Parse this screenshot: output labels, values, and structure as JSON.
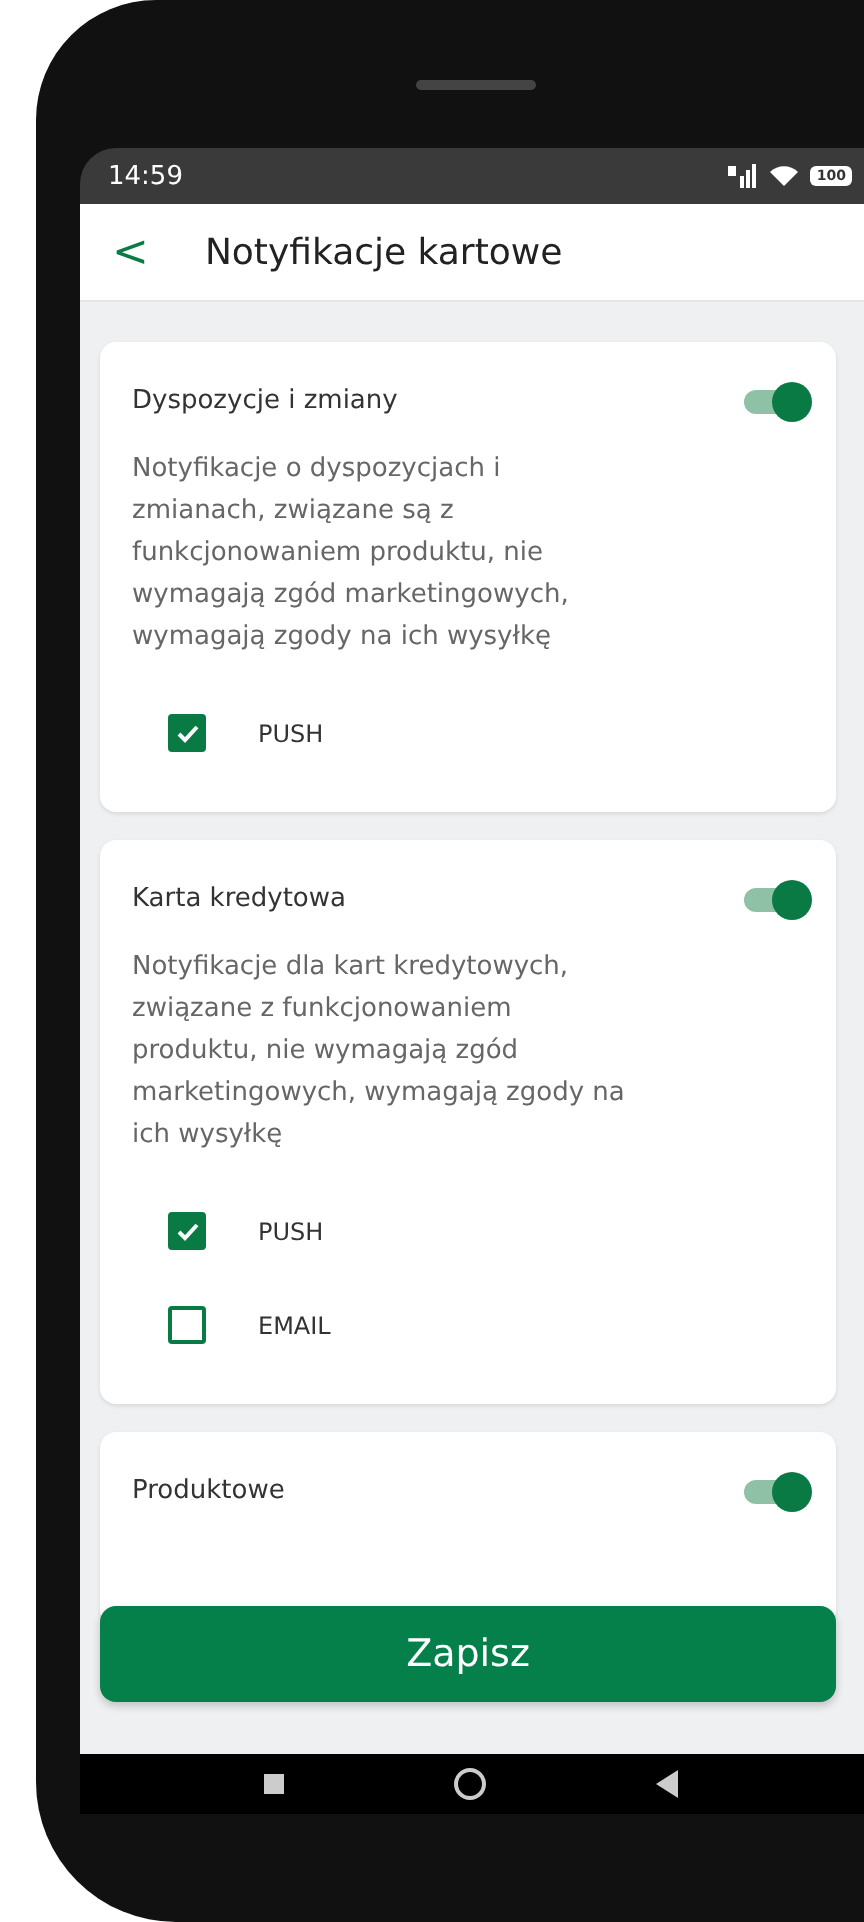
{
  "status_bar": {
    "time": "14:59",
    "battery": "100"
  },
  "header": {
    "back": "<",
    "title": "Notyfikacje kartowe"
  },
  "sections": [
    {
      "title": "Dyspozycje i zmiany",
      "on": true,
      "description": "Notyfikacje o dyspozycjach i zmianach, związane są z funkcjonowaniem produktu, nie wymagają zgód marketingowych, wymagają zgody na ich wysyłkę",
      "options": [
        {
          "label": "PUSH",
          "checked": true
        }
      ]
    },
    {
      "title": "Karta kredytowa",
      "on": true,
      "description": "Notyfikacje dla kart kredytowych, związane z funkcjonowaniem produktu, nie wymagają zgód marketingowych, wymagają zgody na ich wysyłkę",
      "options": [
        {
          "label": "PUSH",
          "checked": true
        },
        {
          "label": "EMAIL",
          "checked": false
        }
      ]
    },
    {
      "title": "Produktowe",
      "on": true
    }
  ],
  "save_button": "Zapisz"
}
